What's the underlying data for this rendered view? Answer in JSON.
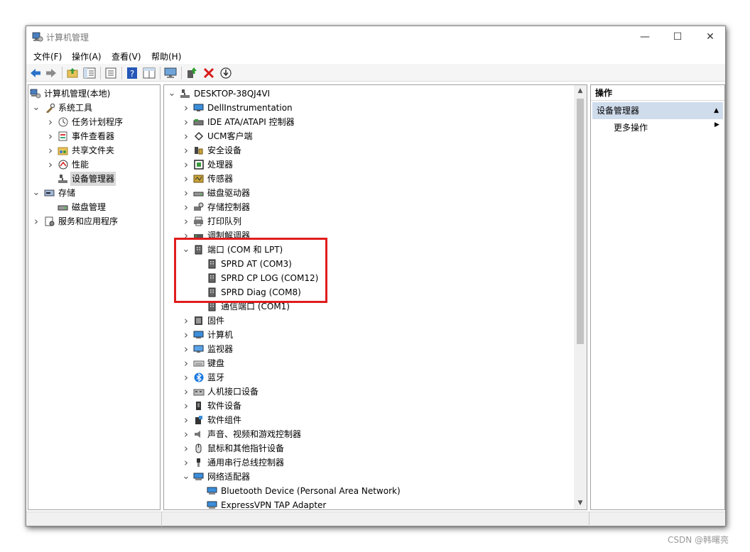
{
  "window": {
    "title": "计算机管理",
    "minimize": "—",
    "maximize": "☐",
    "close": "✕"
  },
  "menu": [
    "文件(F)",
    "操作(A)",
    "查看(V)",
    "帮助(H)"
  ],
  "toolbar": {
    "buttons": [
      "back-icon",
      "forward-icon",
      "up-folder-icon",
      "show-tree-icon",
      "properties-icon",
      "help-icon",
      "console-tree-icon",
      "monitor-icon",
      "update-driver-icon",
      "uninstall-icon",
      "disable-icon"
    ]
  },
  "left_tree": [
    {
      "label": "计算机管理(本地)",
      "icon": "computer-management-icon",
      "expander": "",
      "selected": false
    },
    {
      "label": "系统工具",
      "icon": "tools-icon",
      "expander": "v",
      "selected": false
    },
    {
      "label": "任务计划程序",
      "icon": "clock-icon",
      "expander": ">",
      "selected": false
    },
    {
      "label": "事件查看器",
      "icon": "event-viewer-icon",
      "expander": ">",
      "selected": false
    },
    {
      "label": "共享文件夹",
      "icon": "shared-folder-icon",
      "expander": ">",
      "selected": false
    },
    {
      "label": "性能",
      "icon": "performance-icon",
      "expander": ">",
      "selected": false
    },
    {
      "label": "设备管理器",
      "icon": "device-manager-icon",
      "expander": "",
      "selected": true
    },
    {
      "label": "存储",
      "icon": "storage-icon",
      "expander": "v",
      "selected": false
    },
    {
      "label": "磁盘管理",
      "icon": "disk-icon",
      "expander": "",
      "selected": false
    },
    {
      "label": "服务和应用程序",
      "icon": "services-icon",
      "expander": ">",
      "selected": false
    }
  ],
  "device_tree": {
    "root": "DESKTOP-38QJ4VI",
    "items": [
      {
        "label": "DellInstrumentation",
        "icon": "monitor-icon",
        "expander": ">",
        "child": false
      },
      {
        "label": "IDE ATA/ATAPI 控制器",
        "icon": "ide-controller-icon",
        "expander": ">",
        "child": false
      },
      {
        "label": "UCM客户端",
        "icon": "ucm-icon",
        "expander": ">",
        "child": false
      },
      {
        "label": "安全设备",
        "icon": "security-icon",
        "expander": ">",
        "child": false
      },
      {
        "label": "处理器",
        "icon": "cpu-icon",
        "expander": ">",
        "child": false
      },
      {
        "label": "传感器",
        "icon": "sensor-icon",
        "expander": ">",
        "child": false
      },
      {
        "label": "磁盘驱动器",
        "icon": "disk-drive-icon",
        "expander": ">",
        "child": false
      },
      {
        "label": "存储控制器",
        "icon": "storage-controller-icon",
        "expander": ">",
        "child": false
      },
      {
        "label": "打印队列",
        "icon": "printer-icon",
        "expander": ">",
        "child": false
      },
      {
        "label": "调制解调器",
        "icon": "modem-icon",
        "expander": ">",
        "child": false
      },
      {
        "label": "端口 (COM 和 LPT)",
        "icon": "port-icon",
        "expander": "v",
        "child": false
      },
      {
        "label": "SPRD AT (COM3)",
        "icon": "port-icon",
        "expander": "",
        "child": true
      },
      {
        "label": "SPRD CP LOG (COM12)",
        "icon": "port-icon",
        "expander": "",
        "child": true
      },
      {
        "label": "SPRD Diag (COM8)",
        "icon": "port-icon",
        "expander": "",
        "child": true
      },
      {
        "label": "通信端口 (COM1)",
        "icon": "port-icon",
        "expander": "",
        "child": true
      },
      {
        "label": "固件",
        "icon": "firmware-icon",
        "expander": ">",
        "child": false
      },
      {
        "label": "计算机",
        "icon": "computer-icon",
        "expander": ">",
        "child": false
      },
      {
        "label": "监视器",
        "icon": "display-icon",
        "expander": ">",
        "child": false
      },
      {
        "label": "键盘",
        "icon": "keyboard-icon",
        "expander": ">",
        "child": false
      },
      {
        "label": "蓝牙",
        "icon": "bluetooth-icon",
        "expander": ">",
        "child": false
      },
      {
        "label": "人机接口设备",
        "icon": "hid-icon",
        "expander": ">",
        "child": false
      },
      {
        "label": "软件设备",
        "icon": "software-device-icon",
        "expander": ">",
        "child": false
      },
      {
        "label": "软件组件",
        "icon": "software-component-icon",
        "expander": ">",
        "child": false
      },
      {
        "label": "声音、视频和游戏控制器",
        "icon": "speaker-icon",
        "expander": ">",
        "child": false
      },
      {
        "label": "鼠标和其他指针设备",
        "icon": "mouse-icon",
        "expander": ">",
        "child": false
      },
      {
        "label": "通用串行总线控制器",
        "icon": "usb-icon",
        "expander": ">",
        "child": false
      },
      {
        "label": "网络适配器",
        "icon": "network-adapter-icon",
        "expander": "v",
        "child": false
      },
      {
        "label": "Bluetooth Device (Personal Area Network)",
        "icon": "network-adapter-icon",
        "expander": "",
        "child": true
      },
      {
        "label": "ExpressVPN TAP Adapter",
        "icon": "network-adapter-icon",
        "expander": "",
        "child": true
      }
    ]
  },
  "actions": {
    "header": "操作",
    "group": "设备管理器",
    "item": "更多操作"
  },
  "watermark": "CSDN @韩曙亮",
  "colors": {
    "highlight_box": "#e01d1d",
    "actions_group_bg": "#cfdcec",
    "selection_bg": "#d9d9d9"
  }
}
